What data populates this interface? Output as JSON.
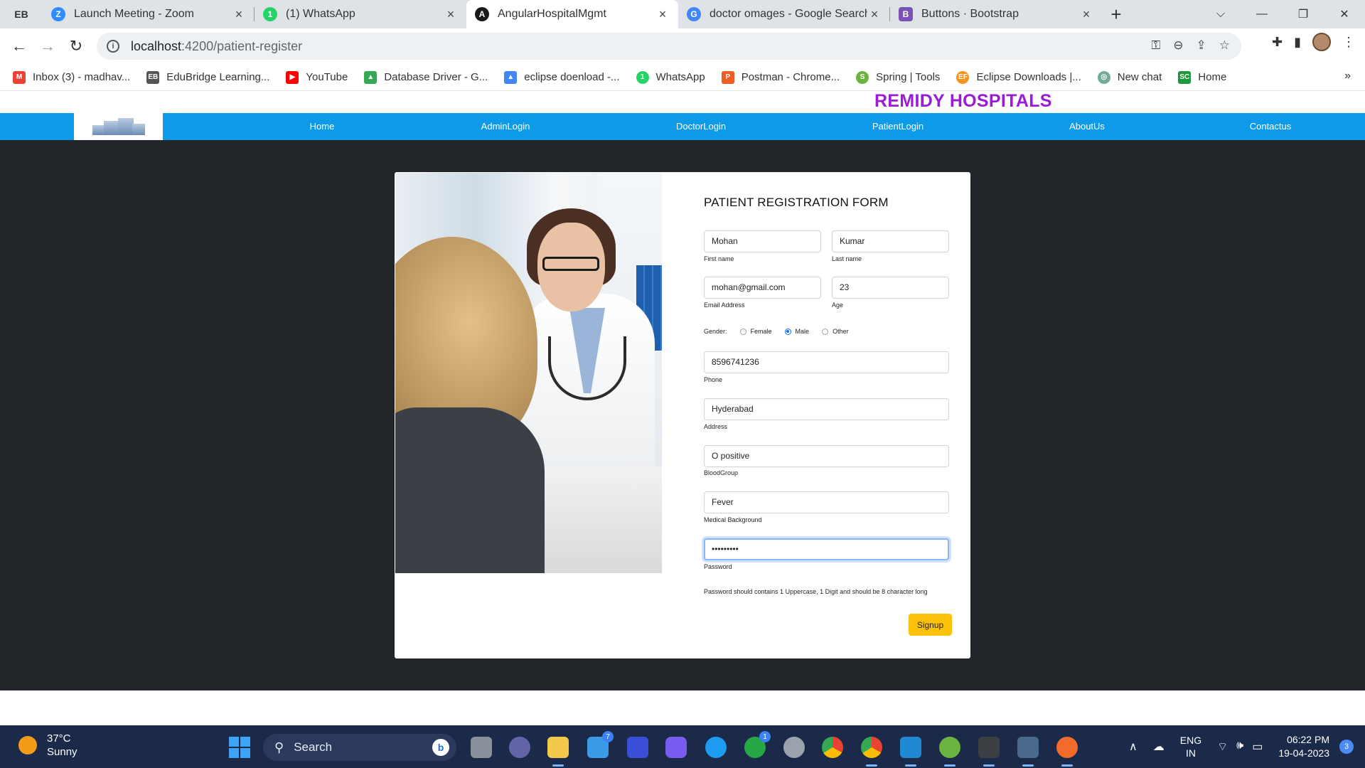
{
  "browser": {
    "tabs": [
      {
        "title": "Launch Meeting - Zoom",
        "icon": "zoom-icon",
        "color": "#2d8cff",
        "glyph": "Z",
        "active": false
      },
      {
        "title": "(1) WhatsApp",
        "icon": "whatsapp-icon",
        "color": "#25d366",
        "glyph": "1",
        "active": false
      },
      {
        "title": "AngularHospitalMgmt",
        "icon": "angular-icon",
        "color": "#1a1a1a",
        "glyph": "A",
        "active": true
      },
      {
        "title": "doctor omages - Google Search",
        "icon": "google-icon",
        "color": "#4285f4",
        "glyph": "G",
        "active": false
      },
      {
        "title": "Buttons · Bootstrap",
        "icon": "bootstrap-icon",
        "color": "#7952b3",
        "glyph": "B",
        "active": false
      }
    ],
    "tab_start_glyph": "EB",
    "url_host": "localhost",
    "url_path": ":4200/patient-register",
    "bookmarks": [
      {
        "label": "Inbox (3) - madhav...",
        "icon": "gmail-icon",
        "color": "#ea4335",
        "glyph": "M"
      },
      {
        "label": "EduBridge Learning...",
        "icon": "edubridge-icon",
        "color": "#555555",
        "glyph": "EB"
      },
      {
        "label": "YouTube",
        "icon": "youtube-icon",
        "color": "#ff0000",
        "glyph": "▶"
      },
      {
        "label": "Database Driver - G...",
        "icon": "google-drive-icon",
        "color": "#34a853",
        "glyph": "▲"
      },
      {
        "label": "eclipse doenload -...",
        "icon": "google-drive-icon",
        "color": "#4285f4",
        "glyph": "▲"
      },
      {
        "label": "WhatsApp",
        "icon": "whatsapp-icon",
        "color": "#25d366",
        "glyph": "1"
      },
      {
        "label": "Postman - Chrome...",
        "icon": "postman-icon",
        "color": "#ef5b25",
        "glyph": "P"
      },
      {
        "label": "Spring | Tools",
        "icon": "spring-icon",
        "color": "#6db33f",
        "glyph": "S"
      },
      {
        "label": "Eclipse Downloads |...",
        "icon": "eclipse-icon",
        "color": "#f7941e",
        "glyph": "EF"
      },
      {
        "label": "New chat",
        "icon": "openai-icon",
        "color": "#74aa9c",
        "glyph": "◎"
      },
      {
        "label": "Home",
        "icon": "sc-icon",
        "color": "#1e9a3a",
        "glyph": "SC"
      }
    ]
  },
  "site": {
    "brand": "REMIDY HOSPITALS",
    "nav": [
      "Home",
      "AdminLogin",
      "DoctorLogin",
      "PatientLogin",
      "AboutUs",
      "Contactus"
    ]
  },
  "form": {
    "title": "PATIENT REGISTRATION FORM",
    "first_name": {
      "value": "Mohan",
      "label": "First name"
    },
    "last_name": {
      "value": "Kumar",
      "label": "Last name"
    },
    "email": {
      "value": "mohan@gmail.com",
      "label": "Email Address"
    },
    "age": {
      "value": "23",
      "label": "Age"
    },
    "gender": {
      "label": "Gender:",
      "options": [
        "Female",
        "Male",
        "Other"
      ],
      "selected": "Male"
    },
    "phone": {
      "value": "8596741236",
      "label": "Phone"
    },
    "address": {
      "value": "Hyderabad",
      "label": "Address"
    },
    "blood_group": {
      "value": "O positive",
      "label": "BloodGroup"
    },
    "medical_background": {
      "value": "Fever",
      "label": "Medical Background"
    },
    "password": {
      "value": "•••••••••",
      "label": "Password"
    },
    "password_hint": "Password should contains 1 Uppercase, 1 Digit and should be 8 character long",
    "signup_label": "Signup",
    "signup_color": "#fec10a"
  },
  "taskbar": {
    "weather_temp": "37°C",
    "weather_desc": "Sunny",
    "search_label": "Search",
    "language_line1": "ENG",
    "language_line2": "IN",
    "time": "06:22 PM",
    "date": "19-04-2023",
    "notification_count": "3",
    "mail_badge": "7",
    "xbox_badge": "1"
  }
}
